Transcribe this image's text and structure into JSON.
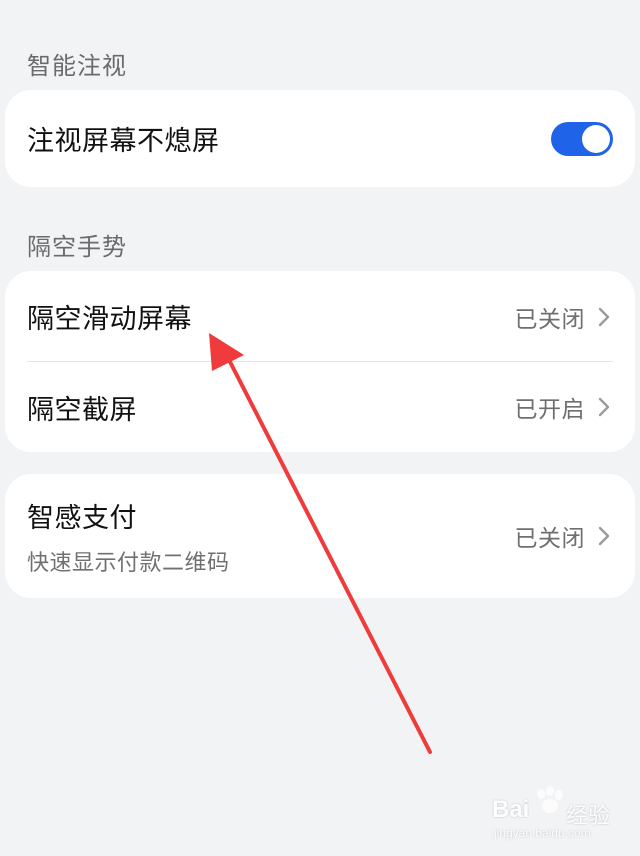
{
  "sections": {
    "smart_gaze": {
      "header": "智能注视",
      "items": [
        {
          "title": "注视屏幕不熄屏",
          "toggle_on": true
        }
      ]
    },
    "air_gesture": {
      "header": "隔空手势",
      "items": [
        {
          "title": "隔空滑动屏幕",
          "value": "已关闭"
        },
        {
          "title": "隔空截屏",
          "value": "已开启"
        }
      ]
    },
    "smart_pay": {
      "items": [
        {
          "title": "智感支付",
          "subtitle": "快速显示付款二维码",
          "value": "已关闭"
        }
      ]
    }
  },
  "watermark": {
    "brand": "Bai",
    "brand_cn": "经验",
    "url": "jingyan.baidu.com"
  },
  "colors": {
    "background": "#f1f3f5",
    "card": "#ffffff",
    "toggle_on": "#1f64e8",
    "arrow": "#ef3b3b"
  },
  "icons": {
    "chevron": "chevron-right-icon",
    "annotation": "red-arrow-annotation"
  }
}
